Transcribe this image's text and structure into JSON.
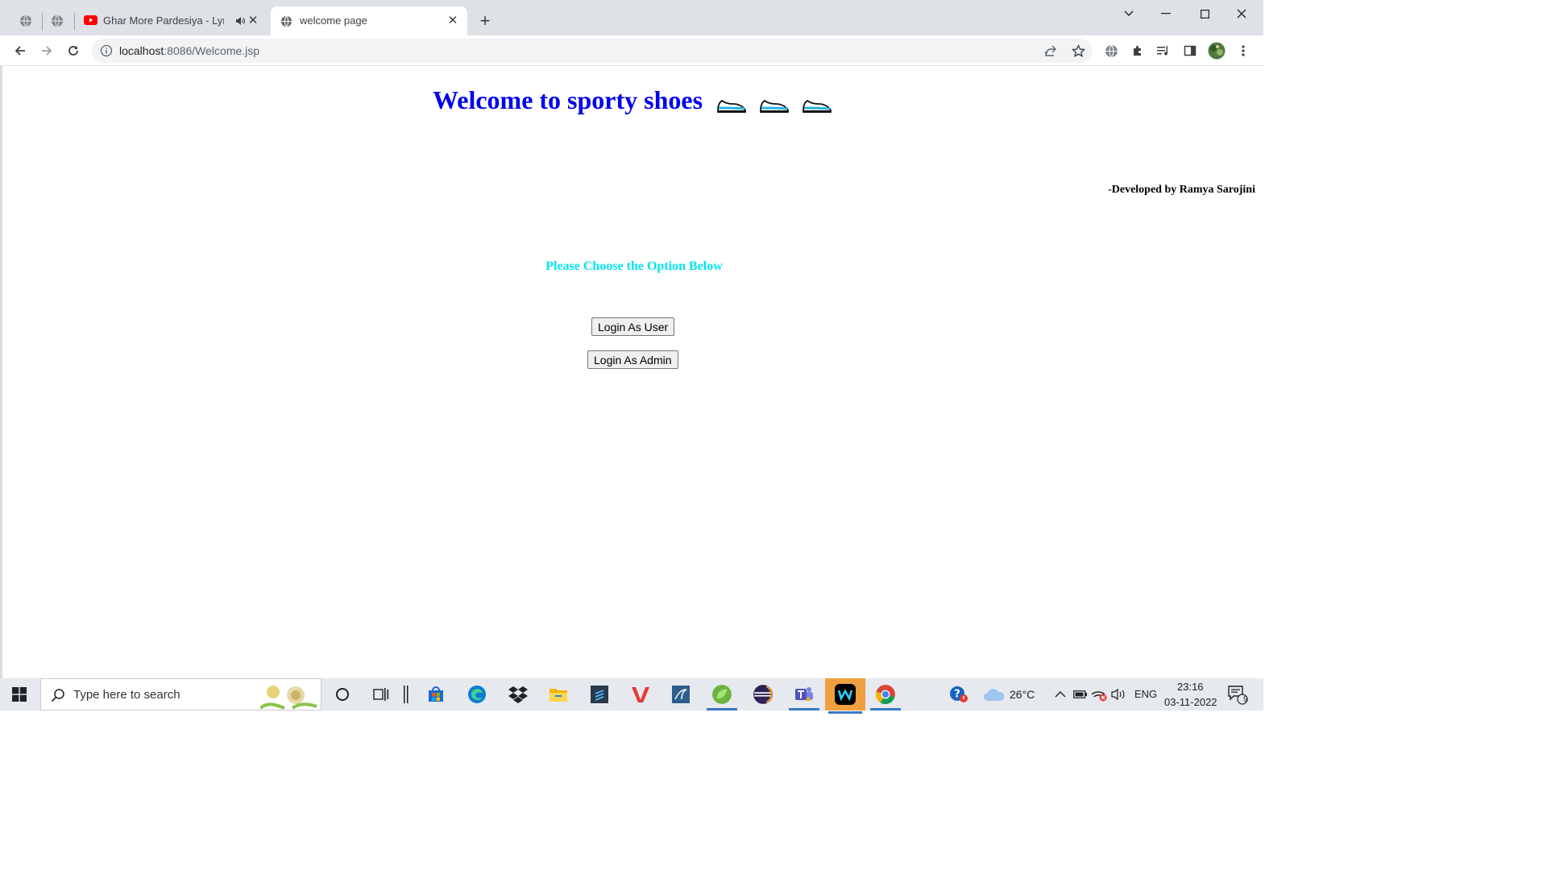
{
  "browser": {
    "tabs": [
      {
        "title": "Ghar More Pardesiya - Lyrical",
        "audio": true
      },
      {
        "title": "welcome page",
        "active": true
      }
    ],
    "url_host": "localhost",
    "url_path": ":8086/Welcome.jsp"
  },
  "page": {
    "headline": "Welcome to sporty shoes",
    "credit": "-Developed by Ramya Sarojini",
    "prompt": "Please Choose the Option Below",
    "buttons": {
      "login_user": "Login As User",
      "login_admin": "Login As Admin"
    },
    "colors": {
      "headline": "#0000ee",
      "prompt": "#00e5ee"
    }
  },
  "taskbar": {
    "search_placeholder": "Type here to search",
    "weather": "26°C",
    "language": "ENG",
    "time": "23:16",
    "date": "03-11-2022",
    "notification_count": "9"
  }
}
